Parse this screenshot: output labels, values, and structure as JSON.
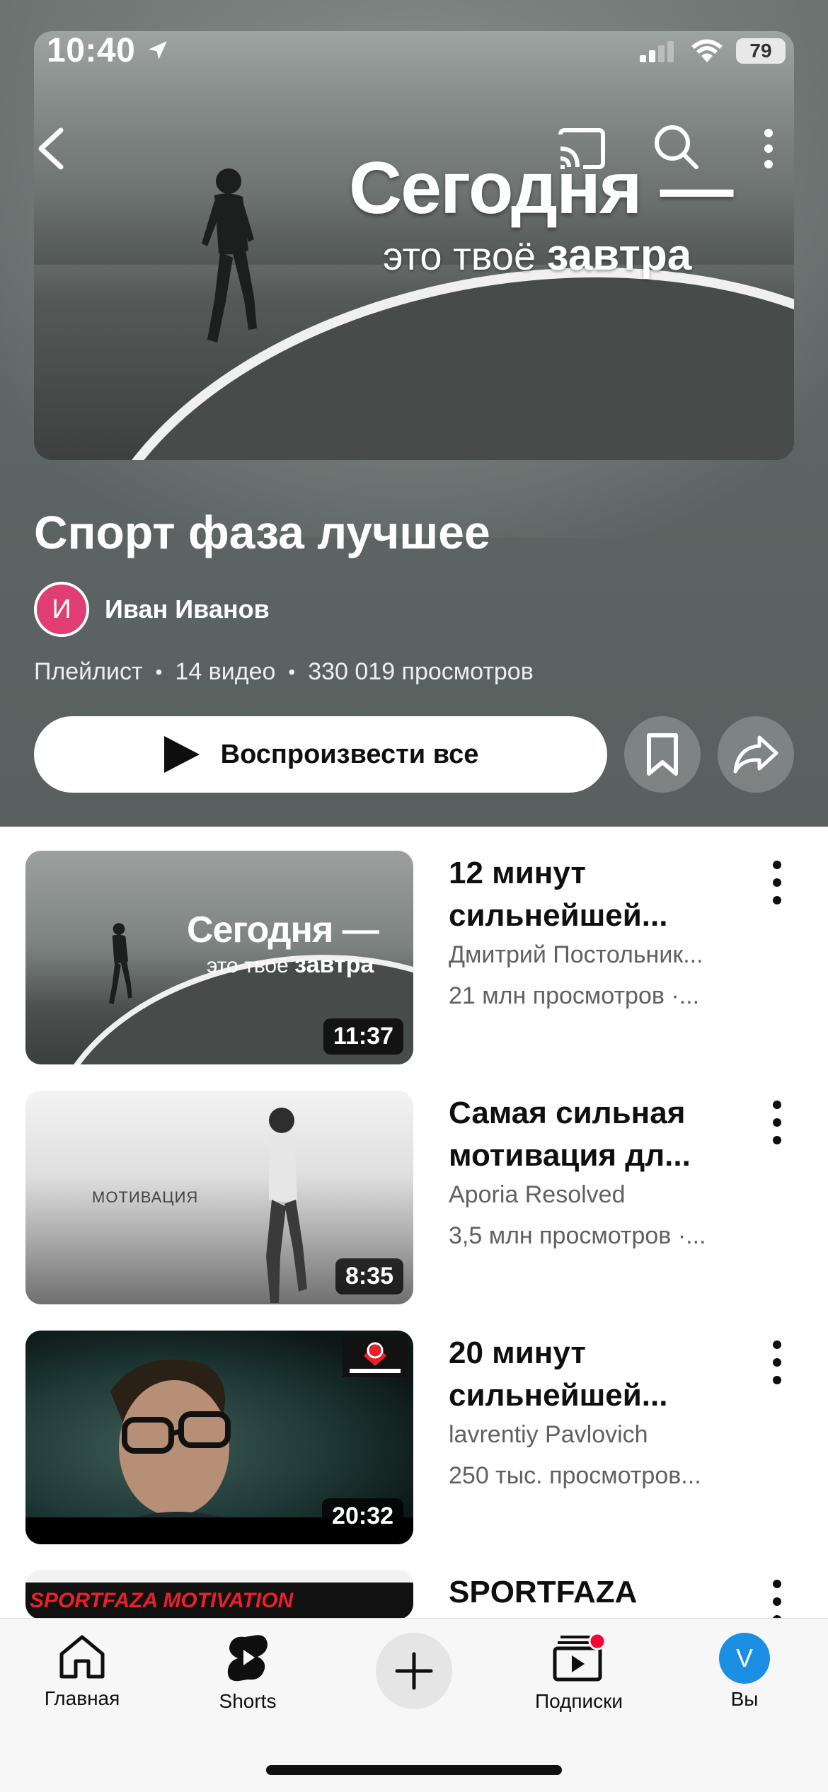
{
  "status_bar": {
    "time": "10:40",
    "battery": "79"
  },
  "cover": {
    "line1": "Сегодня —",
    "line2_pre": "это",
    "line2_mid": "твоё",
    "line2_end": "завтра"
  },
  "playlist": {
    "title": "Спорт фаза лучшее",
    "owner_initial": "И",
    "owner_name": "Иван Иванов",
    "meta": {
      "type": "Плейлист",
      "count": "14 видео",
      "views": "330 019 просмотров"
    },
    "play_all_label": "Воспроизвести все"
  },
  "videos": [
    {
      "title": "12 минут сильнейшей...",
      "channel": "Дмитрий Постольник...",
      "views": "21 млн просмотров ·...",
      "duration": "11:37",
      "thumb_line1": "Сегодня —",
      "thumb_pre": "это",
      "thumb_mid": "твоё",
      "thumb_end": "завтра"
    },
    {
      "title": "Самая сильная мотивация дл...",
      "channel": "Aporia Resolved",
      "views": "3,5 млн просмотров ·...",
      "duration": "8:35",
      "thumb_text": "МОТИВАЦИЯ"
    },
    {
      "title": "20 минут сильнейшей...",
      "channel": "lavrentiy Pavlovich",
      "views": "250 тыс. просмотров...",
      "duration": "20:32"
    },
    {
      "title": "SPORTFAZA",
      "thumb_text": "SPORTFAZA MOTIVATION"
    }
  ],
  "nav": {
    "home": "Главная",
    "shorts": "Shorts",
    "subscriptions": "Подписки",
    "you": "Вы",
    "you_initial": "V"
  },
  "colors": {
    "accent_red": "#ff0033",
    "avatar_owner": "#e03d72",
    "avatar_you": "#1a8fe3"
  }
}
